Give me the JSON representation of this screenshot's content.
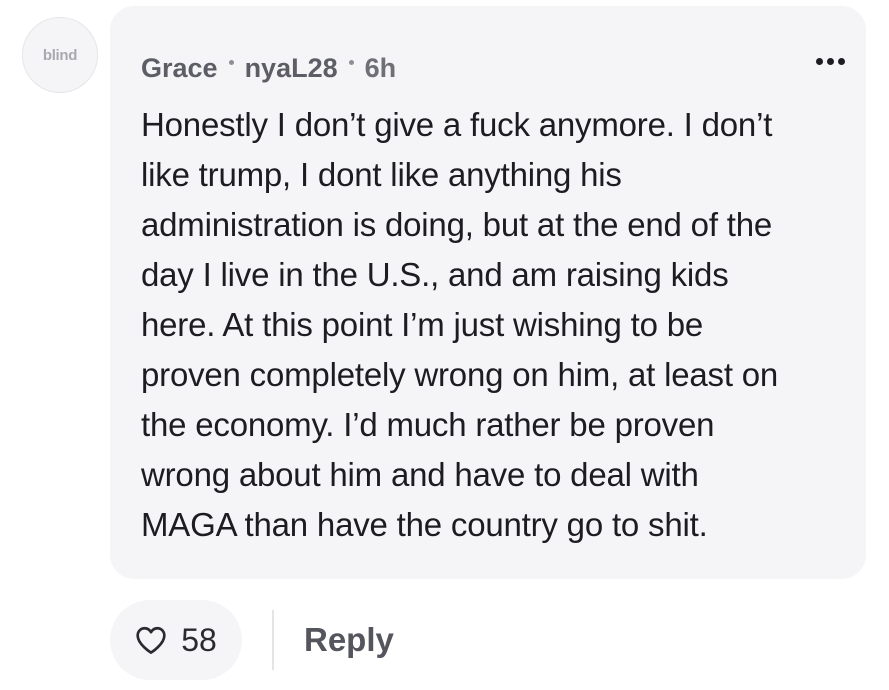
{
  "avatar": {
    "label": "blind"
  },
  "comment": {
    "author": "Grace",
    "handle": "nyaL28",
    "time": "6h",
    "text": "Honestly I don’t give a fuck anymore. I don’t\nlike trump, I dont like anything his\nadministration is doing, but at the end of the\nday I live in the U.S., and am raising kids\nhere. At this point I’m just wishing to be\nproven completely wrong on him, at least on\nthe economy. I’d much rather be proven\nwrong about him and have to deal with\nMAGA than have the country go to shit."
  },
  "actions": {
    "like_count": "58",
    "reply_label": "Reply"
  },
  "icons": {
    "more": "more-horizontal-icon",
    "like": "heart-icon"
  },
  "colors": {
    "bubble_bg": "#f5f5f7",
    "text": "#1c1c21",
    "muted": "#6f6f78"
  }
}
